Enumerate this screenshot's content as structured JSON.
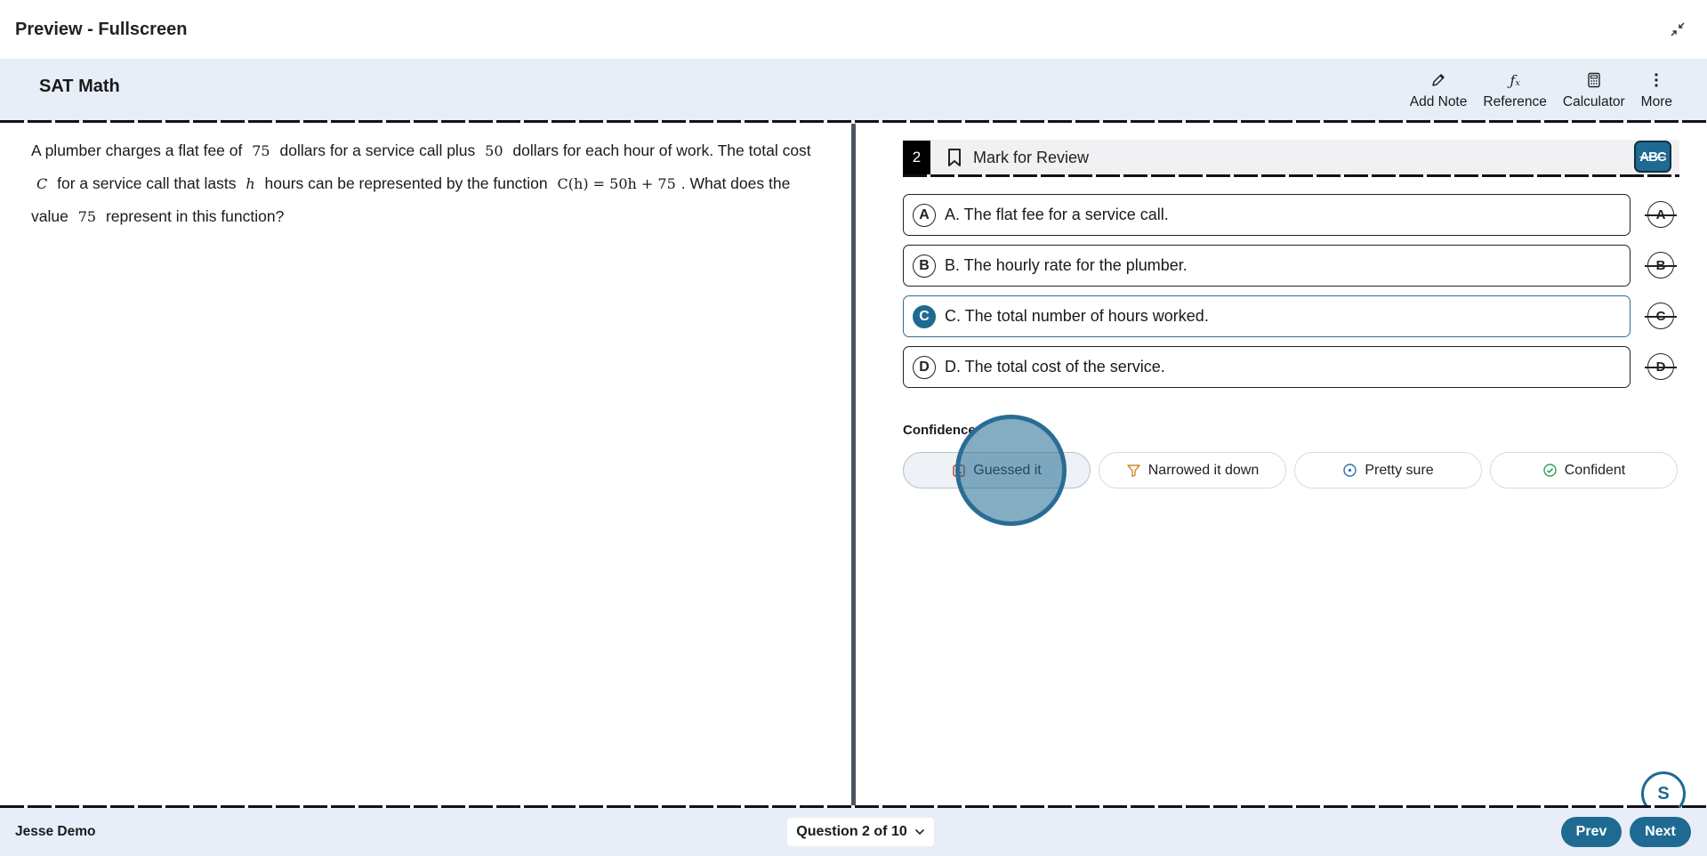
{
  "preview": {
    "title": "Preview - Fullscreen"
  },
  "header": {
    "title": "SAT Math",
    "tools": [
      {
        "label": "Add Note",
        "icon": "pencil-icon"
      },
      {
        "label": "Reference",
        "icon": "fx-icon"
      },
      {
        "label": "Calculator",
        "icon": "calculator-icon"
      },
      {
        "label": "More",
        "icon": "more-vertical-icon"
      }
    ]
  },
  "passage": {
    "parts": [
      "A plumber charges a flat fee of",
      "75",
      "dollars for a service call plus",
      "50",
      "dollars for each hour of work. The total cost",
      "C",
      "for a service call that lasts",
      "h",
      "hours can be represented by the function",
      "C(h) = 50h + 75",
      ". What does the value",
      "75",
      "represent in this function?"
    ]
  },
  "question": {
    "number": "2",
    "mark_label": "Mark for Review",
    "abc_label": "ABC",
    "choices": [
      {
        "letter": "A",
        "text": "A. The flat fee for a service call.",
        "selected": false
      },
      {
        "letter": "B",
        "text": "B. The hourly rate for the plumber.",
        "selected": false
      },
      {
        "letter": "C",
        "text": "C. The total number of hours worked.",
        "selected": true
      },
      {
        "letter": "D",
        "text": "D. The total cost of the service.",
        "selected": false
      }
    ]
  },
  "confidence": {
    "label": "Confidence",
    "options": [
      {
        "label": "Guessed it",
        "icon": "dice-icon"
      },
      {
        "label": "Narrowed it down",
        "icon": "filter-icon"
      },
      {
        "label": "Pretty sure",
        "icon": "target-icon"
      },
      {
        "label": "Confident",
        "icon": "check-circle-icon"
      }
    ]
  },
  "helper": {
    "label": "S"
  },
  "footer": {
    "student": "Jesse Demo",
    "question_nav": "Question 2 of 10",
    "prev": "Prev",
    "next": "Next"
  },
  "colors": {
    "accent": "#1f6a92",
    "header_bg": "#e8eef8"
  }
}
